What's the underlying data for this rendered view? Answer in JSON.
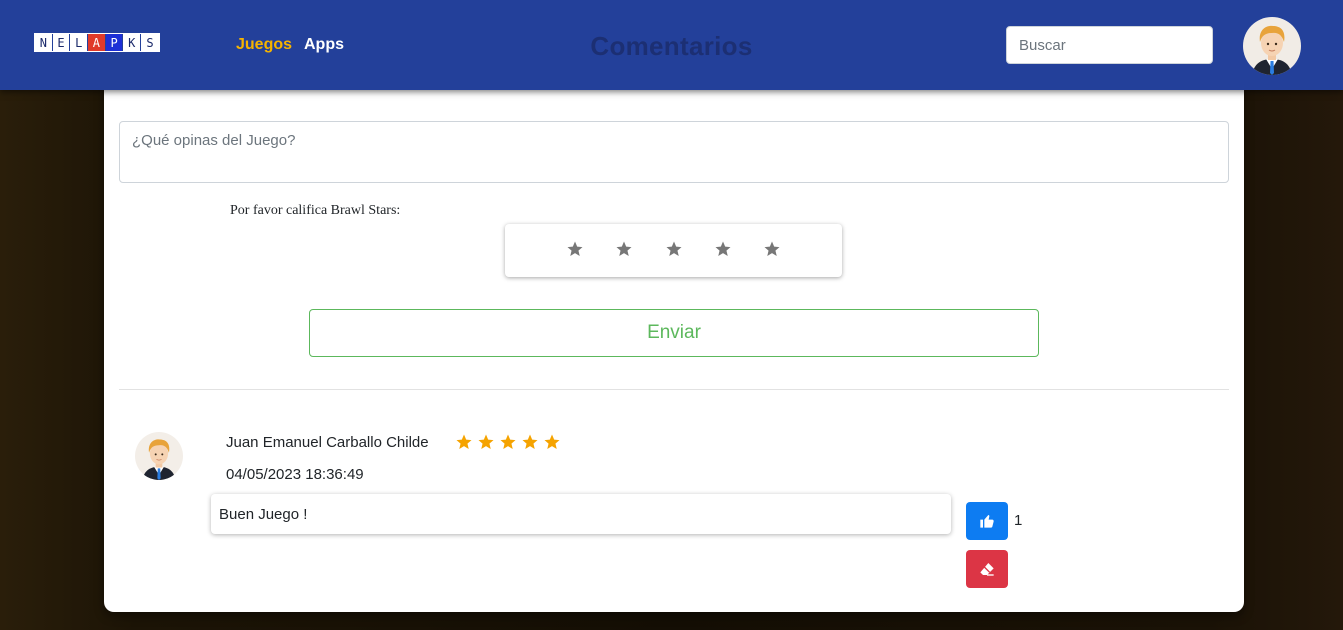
{
  "navbar": {
    "logo_letters": [
      "N",
      "E",
      "L",
      "A",
      "P",
      "K",
      "S"
    ],
    "links": [
      {
        "label": "Juegos",
        "active": true
      },
      {
        "label": "Apps",
        "active": false
      }
    ],
    "title": "Comentarios",
    "search_placeholder": "Buscar",
    "avatar_icon": "user-avatar-icon"
  },
  "form": {
    "comment_placeholder": "¿Qué opinas del Juego?",
    "rate_label": "Por favor califica Brawl Stars:",
    "rating_max": 5,
    "rating_selected": 0,
    "submit_label": "Enviar"
  },
  "comments": [
    {
      "author": "Juan Emanuel Carballo Childe",
      "rating": 5,
      "date": "04/05/2023 18:36:49",
      "text": "Buen Juego !",
      "likes": "1"
    }
  ],
  "colors": {
    "navbar": "#23409a",
    "active_link": "#f5b300",
    "star_filled": "#f5a300",
    "star_empty": "#777777",
    "success": "#5cb85c",
    "like": "#0d7cf2",
    "delete": "#dc3545"
  }
}
